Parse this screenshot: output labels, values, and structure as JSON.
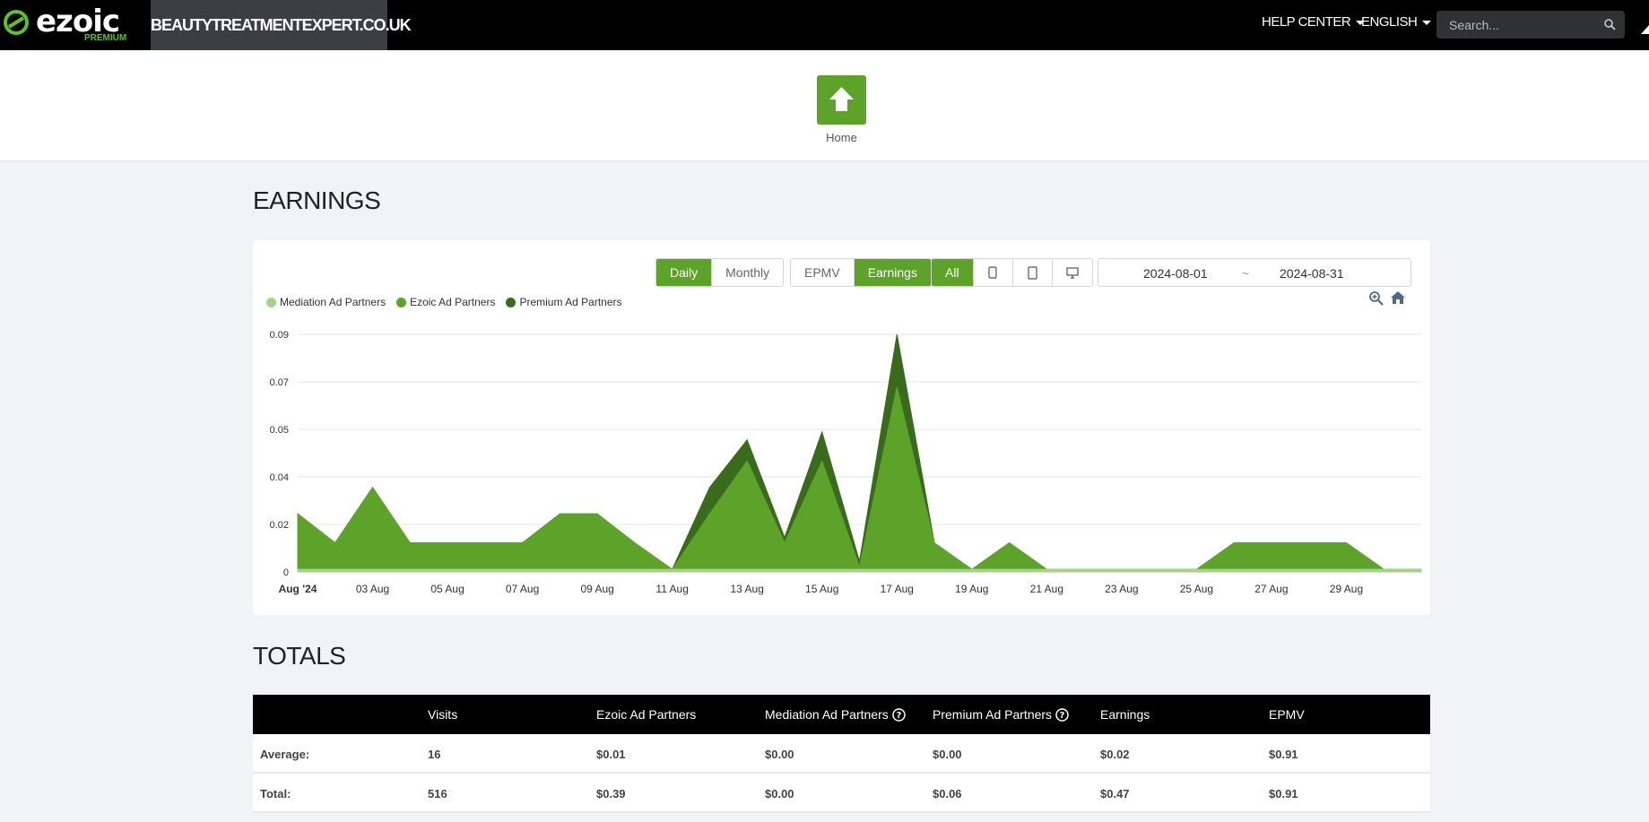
{
  "topnav": {
    "logo_text": "ezoic",
    "logo_sub": "PREMIUM",
    "site": "BEAUTYTREATMENTEXPERT.CO.UK",
    "help_center": "HELP CENTER",
    "language": "ENGLISH",
    "search_placeholder": "Search..."
  },
  "home": {
    "label": "Home"
  },
  "earnings": {
    "title": "EARNINGS",
    "period_buttons": [
      "Daily",
      "Monthly"
    ],
    "metric_buttons": [
      "EPMV",
      "Earnings"
    ],
    "device_all": "All",
    "date_start": "2024-08-01",
    "date_sep": "~",
    "date_end": "2024-08-31"
  },
  "colors": {
    "accent": "#5da32a",
    "mediation": "#a6d28a",
    "ezoic": "#5da32a",
    "premium": "#3a6a1c"
  },
  "chart_data": {
    "type": "area",
    "stacked": true,
    "x": [
      "2024-08-01",
      "2024-08-02",
      "2024-08-03",
      "2024-08-04",
      "2024-08-05",
      "2024-08-06",
      "2024-08-07",
      "2024-08-08",
      "2024-08-09",
      "2024-08-10",
      "2024-08-11",
      "2024-08-12",
      "2024-08-13",
      "2024-08-14",
      "2024-08-15",
      "2024-08-16",
      "2024-08-17",
      "2024-08-18",
      "2024-08-19",
      "2024-08-20",
      "2024-08-21",
      "2024-08-22",
      "2024-08-23",
      "2024-08-24",
      "2024-08-25",
      "2024-08-26",
      "2024-08-27",
      "2024-08-28",
      "2024-08-29",
      "2024-08-30",
      "2024-08-31"
    ],
    "x_tick_labels": [
      "Aug '24",
      "03 Aug",
      "05 Aug",
      "07 Aug",
      "09 Aug",
      "11 Aug",
      "13 Aug",
      "15 Aug",
      "17 Aug",
      "19 Aug",
      "21 Aug",
      "23 Aug",
      "25 Aug",
      "27 Aug",
      "29 Aug"
    ],
    "y_tick_labels": [
      "0",
      "0.02",
      "0.04",
      "0.05",
      "0.07",
      "0.09"
    ],
    "y_ticks": [
      0,
      0.018,
      0.036,
      0.054,
      0.072,
      0.09
    ],
    "ylim": [
      0,
      0.09
    ],
    "legend_position": "top-left",
    "grid": true,
    "series": [
      {
        "name": "Mediation Ad Partners",
        "values": [
          0.001,
          0.001,
          0.001,
          0.001,
          0.001,
          0.001,
          0.001,
          0.001,
          0.001,
          0.001,
          0.001,
          0.001,
          0.001,
          0.001,
          0.001,
          0.001,
          0.001,
          0.001,
          0.001,
          0.001,
          0.001,
          0.001,
          0.001,
          0.001,
          0.001,
          0.001,
          0.001,
          0.001,
          0.001,
          0.001,
          0.001
        ]
      },
      {
        "name": "Ezoic Ad Partners",
        "values": [
          0.021,
          0.01,
          0.031,
          0.01,
          0.01,
          0.01,
          0.01,
          0.021,
          0.021,
          0.01,
          0,
          0.021,
          0.041,
          0.01,
          0.041,
          0.001,
          0.069,
          0.01,
          0,
          0.01,
          0,
          0,
          0,
          0,
          0,
          0.01,
          0.01,
          0.01,
          0.01,
          0,
          0
        ]
      },
      {
        "name": "Premium Ad Partners",
        "values": [
          0,
          0,
          0,
          0,
          0,
          0,
          0,
          0,
          0,
          0,
          0,
          0.01,
          0.008,
          0.002,
          0.011,
          0.002,
          0.02,
          0,
          0,
          0,
          0,
          0,
          0,
          0,
          0,
          0,
          0,
          0,
          0,
          0,
          0
        ]
      }
    ]
  },
  "totals": {
    "title": "TOTALS",
    "columns": [
      "Visits",
      "Ezoic Ad Partners",
      "Mediation Ad Partners",
      "Premium Ad Partners",
      "Earnings",
      "EPMV"
    ],
    "rows": [
      {
        "label": "Average:",
        "values": [
          "16",
          "$0.01",
          "$0.00",
          "$0.00",
          "$0.02",
          "$0.91"
        ]
      },
      {
        "label": "Total:",
        "values": [
          "516",
          "$0.39",
          "$0.00",
          "$0.06",
          "$0.47",
          "$0.91"
        ]
      }
    ]
  }
}
